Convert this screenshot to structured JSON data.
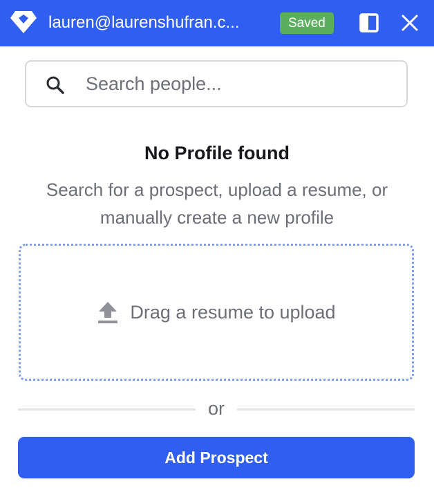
{
  "header": {
    "account": "lauren@laurenshufran.c...",
    "status_badge": "Saved",
    "icons": {
      "logo": "diamond-logo-icon",
      "maximize": "maximize-square-icon",
      "close": "close-x-icon"
    }
  },
  "search": {
    "placeholder": "Search people...",
    "value": "",
    "icon": "search-icon"
  },
  "empty_state": {
    "title": "No Profile found",
    "description": "Search for a prospect, upload a resume, or manually create a new profile"
  },
  "dropzone": {
    "label": "Drag a resume to upload",
    "icon": "upload-arrow-icon"
  },
  "divider": {
    "label": "or"
  },
  "actions": {
    "add_prospect": "Add Prospect"
  },
  "colors": {
    "brand": "#2f5ef0",
    "saved_badge": "#5bae5d",
    "dropzone_border": "#7b9ef2",
    "muted_text": "#6c6f78"
  }
}
